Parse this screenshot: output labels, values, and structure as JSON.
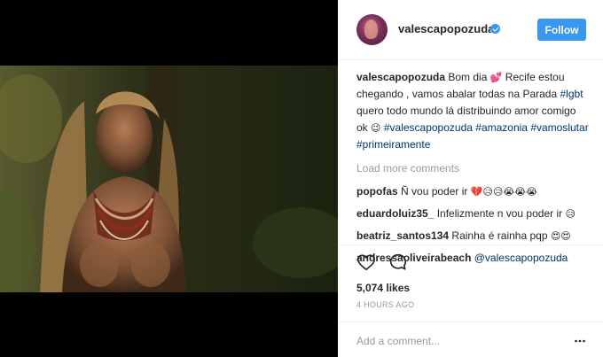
{
  "post": {
    "username": "valescapopozuda",
    "follow_label": "Follow",
    "caption": {
      "text_1": "Bom dia",
      "emoji_1": "💕",
      "text_2": "Recife estou chegando , vamos abalar todas na Parada",
      "tag_1": "#lgbt",
      "text_3": "quero todo mundo lá distribuindo amor comigo ok",
      "emoji_2": "😉",
      "tag_2": "#valescapopozuda",
      "tag_3": "#amazonia",
      "tag_4": "#vamoslutar",
      "tag_5": "#primeiramente"
    },
    "load_more_label": "Load more comments",
    "comments": [
      {
        "user": "popofas",
        "text": "Ñ vou poder ir",
        "emoji": "💔😥😥😭😭😭"
      },
      {
        "user": "eduardoluiz35_",
        "text": "Infelizmente n vou poder ir",
        "emoji": "😥"
      },
      {
        "user": "beatriz_santos134",
        "text": "Rainha é rainha pqp",
        "emoji": "😍😍"
      },
      {
        "user": "andressaoliveirabeach",
        "text": "@valescapopozuda",
        "emoji": ""
      }
    ],
    "likes": "5,074 likes",
    "time_ago": "4 HOURS AGO",
    "add_comment_placeholder": "Add a comment..."
  },
  "icons": {
    "verified": "verified-badge-icon",
    "like": "heart-icon",
    "comment": "comment-bubble-icon",
    "more": "more-options-icon"
  },
  "colors": {
    "accent": "#3897f0",
    "hashtag": "#003569",
    "muted": "#999999"
  }
}
